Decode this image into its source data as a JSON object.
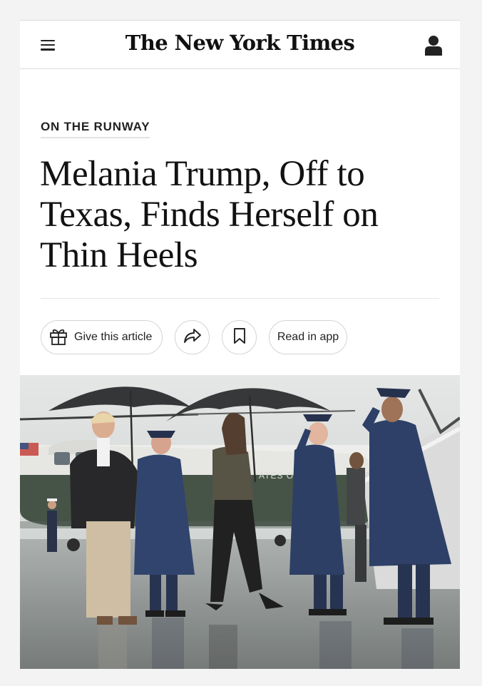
{
  "header": {
    "masthead": "The New York Times",
    "menu_icon": "hamburger-menu-icon",
    "account_icon": "user-account-icon"
  },
  "article": {
    "kicker": "ON THE RUNWAY",
    "headline_lines": [
      "Melania Trump, Off to",
      "Texas, Finds Herself on",
      "Thin Heels"
    ]
  },
  "actions": {
    "gift_label": "Give this article",
    "gift_icon": "gift-icon",
    "share_icon": "share-arrow-icon",
    "bookmark_icon": "bookmark-icon",
    "read_in_app_label": "Read in app"
  },
  "photo": {
    "plane_text": "ATES O"
  },
  "colors": {
    "background": "#f3f3f3",
    "text": "#121212",
    "border": "#d4d4d4"
  }
}
